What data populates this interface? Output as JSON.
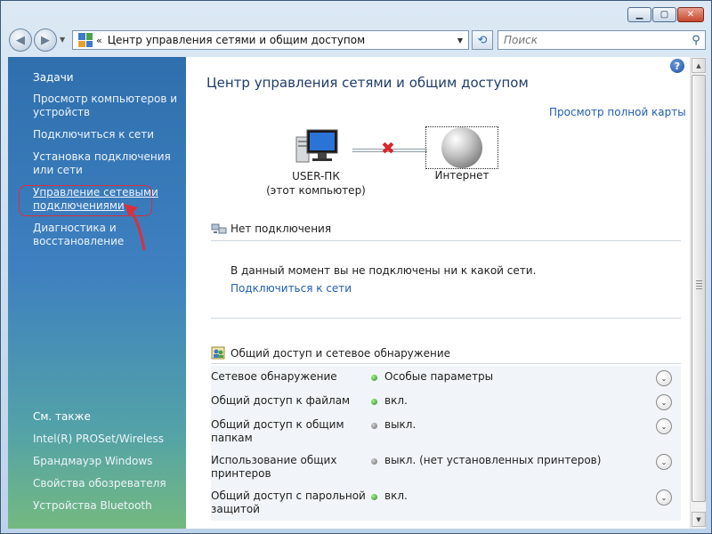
{
  "window": {
    "min_label": "▁",
    "max_label": "▢",
    "close_label": "✕"
  },
  "nav": {
    "back_glyph": "◀",
    "forward_glyph": "▶",
    "history_glyph": "▼",
    "address_chevron": "«",
    "address_text": "Центр управления сетями и общим доступом",
    "address_dropdown_glyph": "▼",
    "refresh_glyph": "⟲",
    "search_placeholder": "Поиск",
    "search_glyph": "⚲"
  },
  "sidebar": {
    "tasks_title": "Задачи",
    "items": [
      {
        "label": "Просмотр компьютеров и устройств"
      },
      {
        "label": "Подключиться к сети"
      },
      {
        "label": "Установка подключения или сети"
      },
      {
        "label": "Управление сетевыми подключениями"
      },
      {
        "label": "Диагностика и восстановление"
      }
    ],
    "see_also_title": "См. также",
    "see_also_items": [
      {
        "label": "Intel(R) PROSet/Wireless"
      },
      {
        "label": "Брандмауэр Windows"
      },
      {
        "label": "Свойства обозревателя"
      },
      {
        "label": "Устройства Bluetooth"
      }
    ]
  },
  "main": {
    "help_glyph": "?",
    "title": "Центр управления сетями и общим доступом",
    "full_map_link": "Просмотр полной карты",
    "computer_name": "USER-ПК",
    "computer_caption": "(этот компьютер)",
    "disconnected_glyph": "✖",
    "internet_label": "Интернет",
    "no_connection_title": "Нет подключения",
    "no_connection_message": "В данный момент вы не подключены ни к какой сети.",
    "connect_link": "Подключиться к сети",
    "sharing_title": "Общий доступ и сетевое обнаружение",
    "expand_glyph": "⌄",
    "sharing_rows": [
      {
        "label": "Сетевое обнаружение",
        "value": "Особые параметры",
        "status": "on"
      },
      {
        "label": "Общий доступ к файлам",
        "value": "вкл.",
        "status": "on"
      },
      {
        "label": "Общий доступ к общим папкам",
        "value": "выкл.",
        "status": "off"
      },
      {
        "label": "Использование общих принтеров",
        "value": "выкл. (нет установленных принтеров)",
        "status": "off"
      },
      {
        "label": "Общий доступ с парольной защитой",
        "value": "вкл.",
        "status": "on"
      }
    ]
  }
}
